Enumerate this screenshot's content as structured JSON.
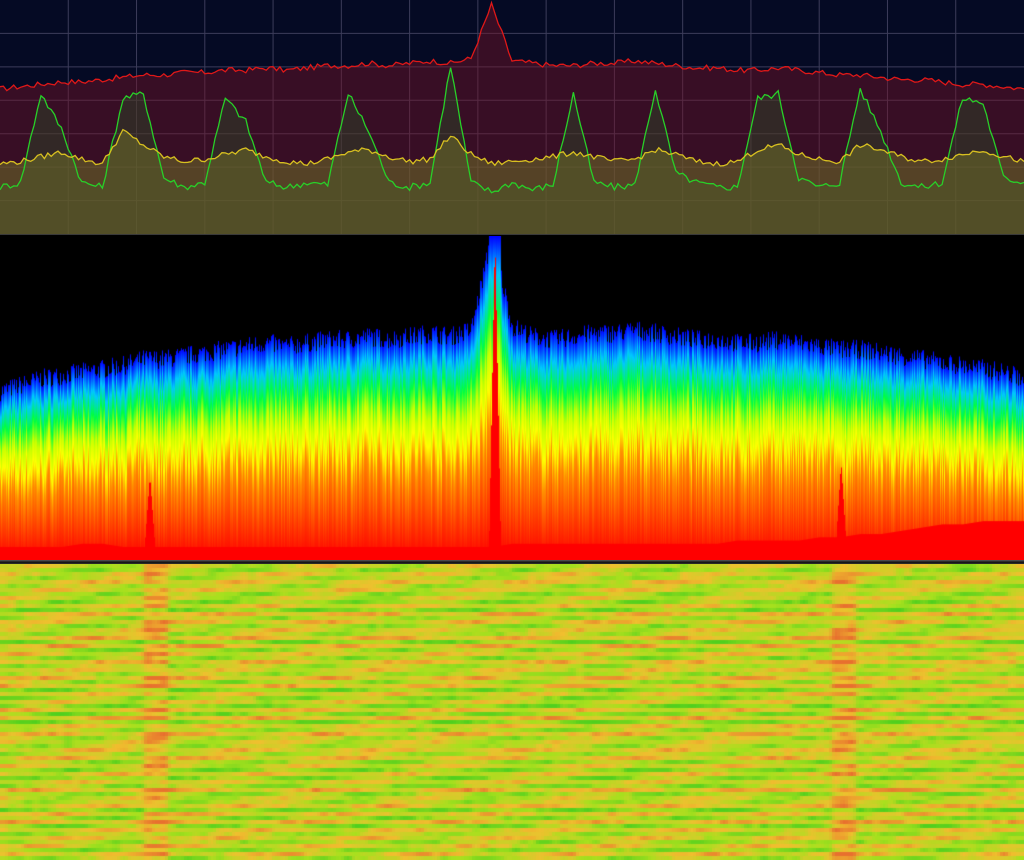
{
  "app": {
    "panels": [
      {
        "id": "trace",
        "kind": "spectrum-traces"
      },
      {
        "id": "density",
        "kind": "density-spectrum"
      },
      {
        "id": "waterfall",
        "kind": "waterfall-spectrogram"
      }
    ]
  },
  "colors": {
    "trace_background": "#050a24",
    "grid": "#3c3c5a",
    "max_hold": "#e01818",
    "current": "#28d028",
    "average": "#d8c020",
    "density_palette": [
      "#0000ff",
      "#00c8ff",
      "#00ff40",
      "#c8ff00",
      "#ffff00",
      "#ff9000",
      "#ff0000"
    ],
    "waterfall_palette": [
      "#50d020",
      "#a8e020",
      "#f0c030",
      "#e87030"
    ]
  },
  "chart_data": [
    {
      "type": "line",
      "panel": "trace",
      "title": "",
      "xlabel": "",
      "ylabel": "",
      "grid": true,
      "grid_divisions": {
        "x": 15,
        "y": 7
      },
      "ylim": [
        0,
        100
      ],
      "x": [
        0,
        2,
        4,
        6,
        8,
        10,
        12,
        14,
        16,
        18,
        20,
        22,
        24,
        26,
        28,
        30,
        32,
        34,
        36,
        38,
        40,
        42,
        44,
        46,
        48,
        50,
        52,
        54,
        56,
        58,
        60,
        62,
        64,
        66,
        68,
        70,
        72,
        74,
        76,
        78,
        80,
        82,
        84,
        86,
        88,
        90,
        92,
        94,
        96,
        98,
        100
      ],
      "series": [
        {
          "role": "max-hold",
          "color": "#e01818",
          "values": [
            62,
            63,
            64,
            65,
            65,
            66,
            67,
            68,
            68,
            69,
            69,
            70,
            70,
            71,
            70,
            71,
            72,
            72,
            73,
            72,
            73,
            74,
            73,
            75,
            98,
            74,
            73,
            72,
            72,
            73,
            73,
            74,
            73,
            72,
            71,
            71,
            70,
            70,
            71,
            70,
            69,
            68,
            68,
            67,
            66,
            66,
            65,
            64,
            64,
            63,
            62
          ]
        },
        {
          "role": "current",
          "color": "#28d028",
          "values": [
            20,
            22,
            60,
            45,
            22,
            20,
            58,
            60,
            24,
            20,
            22,
            58,
            48,
            22,
            20,
            22,
            21,
            60,
            44,
            22,
            20,
            22,
            72,
            22,
            18,
            22,
            19,
            21,
            60,
            22,
            20,
            21,
            62,
            26,
            22,
            20,
            20,
            58,
            60,
            24,
            20,
            22,
            62,
            44,
            22,
            20,
            22,
            58,
            56,
            24,
            22
          ]
        },
        {
          "role": "average",
          "color": "#d8c020",
          "values": [
            30,
            31,
            33,
            35,
            32,
            30,
            44,
            38,
            33,
            31,
            32,
            34,
            36,
            33,
            31,
            30,
            32,
            35,
            36,
            33,
            31,
            32,
            42,
            34,
            30,
            31,
            32,
            33,
            35,
            33,
            31,
            32,
            36,
            34,
            31,
            30,
            31,
            36,
            38,
            34,
            32,
            31,
            38,
            36,
            33,
            31,
            32,
            34,
            36,
            33,
            31
          ]
        }
      ]
    },
    {
      "type": "area",
      "panel": "density",
      "title": "",
      "xlabel": "",
      "ylabel": "",
      "ylim": [
        0,
        100
      ],
      "x": [
        0,
        2,
        4,
        6,
        8,
        10,
        12,
        14,
        16,
        18,
        20,
        22,
        24,
        26,
        28,
        30,
        32,
        34,
        36,
        38,
        40,
        42,
        44,
        46,
        48,
        50,
        52,
        54,
        56,
        58,
        60,
        62,
        64,
        66,
        68,
        70,
        72,
        74,
        76,
        78,
        80,
        82,
        84,
        86,
        88,
        90,
        92,
        94,
        96,
        98,
        100
      ],
      "series": [
        {
          "role": "envelope",
          "values": [
            52,
            54,
            56,
            57,
            58,
            59,
            60,
            62,
            62,
            63,
            64,
            65,
            66,
            67,
            66,
            67,
            68,
            68,
            69,
            68,
            69,
            70,
            69,
            71,
            100,
            72,
            69,
            68,
            69,
            70,
            70,
            71,
            70,
            69,
            68,
            68,
            67,
            67,
            68,
            67,
            66,
            65,
            65,
            64,
            63,
            62,
            61,
            60,
            59,
            58,
            56
          ]
        },
        {
          "role": "floor",
          "values": [
            4,
            4,
            4,
            4,
            5,
            5,
            4,
            4,
            4,
            4,
            4,
            4,
            4,
            4,
            4,
            4,
            4,
            4,
            4,
            4,
            4,
            4,
            4,
            4,
            4,
            5,
            5,
            5,
            5,
            5,
            5,
            5,
            5,
            5,
            5,
            5,
            6,
            6,
            6,
            6,
            7,
            7,
            8,
            8,
            9,
            10,
            11,
            11,
            12,
            12,
            12
          ]
        },
        {
          "role": "hot-spikes",
          "x": [
            14.6,
            48.3,
            82.1
          ],
          "values": [
            26,
            100,
            30
          ]
        }
      ]
    },
    {
      "type": "heatmap",
      "panel": "waterfall",
      "title": "",
      "xlabel": "",
      "ylabel": "",
      "rows": 74,
      "columns": 128,
      "value_range": [
        0,
        1
      ],
      "persistent_columns_x": [
        14.6,
        82.1
      ]
    }
  ]
}
